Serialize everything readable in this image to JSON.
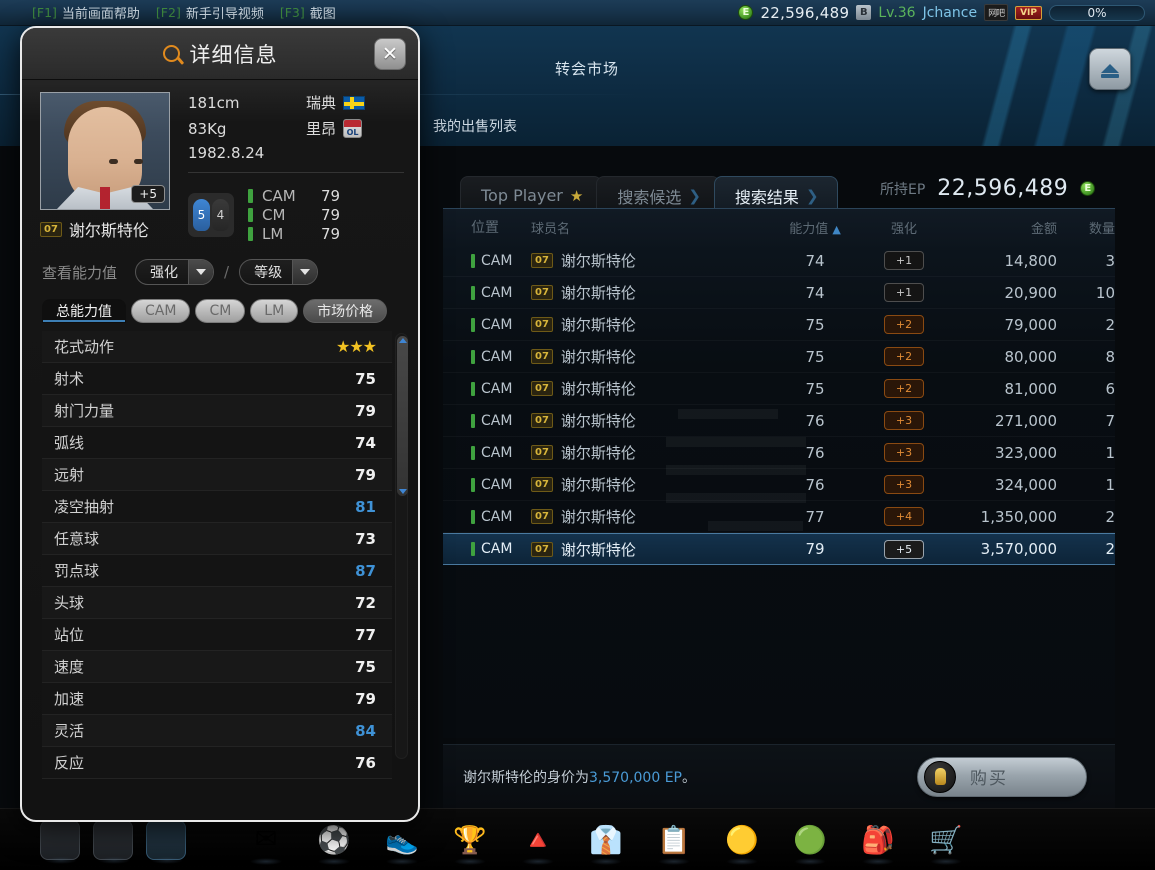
{
  "sysbar": {
    "hotkeys": [
      {
        "key": "[F1]",
        "label": "当前画面帮助"
      },
      {
        "key": "[F2]",
        "label": "新手引导视频"
      },
      {
        "key": "[F3]",
        "label": "截图"
      }
    ],
    "ep_icon": "E",
    "ep_amount": "22,596,489",
    "b_badge": "B",
    "level": "Lv.36",
    "username": "Jchance",
    "tag_forum": "网吧",
    "tag_vip": "VIP",
    "progress": "0%"
  },
  "market": {
    "title": "转会市场",
    "subnav": "我的出售列表",
    "eject_icon": "eject-icon",
    "tabs": [
      {
        "label": "Top Player",
        "icon": "star-icon",
        "active": false
      },
      {
        "label": "搜索候选",
        "icon": "chevron-right-icon",
        "active": false
      },
      {
        "label": "搜索结果",
        "icon": "chevron-right-icon",
        "active": true
      }
    ],
    "ep_hold_label": "所持EP",
    "ep_hold_value": "22,596,489",
    "columns": [
      "位置",
      "球员名",
      "能力值",
      "强化",
      "金额",
      "数量"
    ],
    "sort_indicator": "▲",
    "rows": [
      {
        "pos": "CAM",
        "num": "07",
        "name": "谢尔斯特伦",
        "ovr": "74",
        "enh": "+1",
        "enh_lv": 1,
        "price": "14,800",
        "qty": "3",
        "selected": false
      },
      {
        "pos": "CAM",
        "num": "07",
        "name": "谢尔斯特伦",
        "ovr": "74",
        "enh": "+1",
        "enh_lv": 1,
        "price": "20,900",
        "qty": "10",
        "selected": false
      },
      {
        "pos": "CAM",
        "num": "07",
        "name": "谢尔斯特伦",
        "ovr": "75",
        "enh": "+2",
        "enh_lv": 2,
        "price": "79,000",
        "qty": "2",
        "selected": false
      },
      {
        "pos": "CAM",
        "num": "07",
        "name": "谢尔斯特伦",
        "ovr": "75",
        "enh": "+2",
        "enh_lv": 2,
        "price": "80,000",
        "qty": "8",
        "selected": false
      },
      {
        "pos": "CAM",
        "num": "07",
        "name": "谢尔斯特伦",
        "ovr": "75",
        "enh": "+2",
        "enh_lv": 2,
        "price": "81,000",
        "qty": "6",
        "selected": false
      },
      {
        "pos": "CAM",
        "num": "07",
        "name": "谢尔斯特伦",
        "ovr": "76",
        "enh": "+3",
        "enh_lv": 3,
        "price": "271,000",
        "qty": "7",
        "selected": false
      },
      {
        "pos": "CAM",
        "num": "07",
        "name": "谢尔斯特伦",
        "ovr": "76",
        "enh": "+3",
        "enh_lv": 3,
        "price": "323,000",
        "qty": "1",
        "selected": false
      },
      {
        "pos": "CAM",
        "num": "07",
        "name": "谢尔斯特伦",
        "ovr": "76",
        "enh": "+3",
        "enh_lv": 3,
        "price": "324,000",
        "qty": "1",
        "selected": false
      },
      {
        "pos": "CAM",
        "num": "07",
        "name": "谢尔斯特伦",
        "ovr": "77",
        "enh": "+4",
        "enh_lv": 4,
        "price": "1,350,000",
        "qty": "2",
        "selected": false
      },
      {
        "pos": "CAM",
        "num": "07",
        "name": "谢尔斯特伦",
        "ovr": "79",
        "enh": "+5",
        "enh_lv": 5,
        "price": "3,570,000",
        "qty": "2",
        "selected": true
      }
    ],
    "buy_msg_pre": "谢尔斯特伦的身价为",
    "buy_msg_price": "3,570,000 EP",
    "buy_msg_post": "。",
    "buy_button": "购买"
  },
  "dialog": {
    "title": "详细信息",
    "title_icon": "search-icon",
    "close_icon": "close-icon",
    "player": {
      "height": "181cm",
      "weight": "83Kg",
      "birthdate": "1982.8.24",
      "country": "瑞典",
      "club": "里昂",
      "name": "谢尔斯特伦",
      "shirt_number": "07",
      "enhance_badge": "+5",
      "foot_left": "5",
      "foot_right": "4",
      "positions": [
        {
          "name": "CAM",
          "value": "79"
        },
        {
          "name": "CM",
          "value": "79"
        },
        {
          "name": "LM",
          "value": "79"
        }
      ]
    },
    "view_label": "查看能力值",
    "dropdown_enhance": "强化",
    "dropdown_level": "等级",
    "separator": "/",
    "attr_tabs": [
      {
        "label": "总能力值",
        "style": "on"
      },
      {
        "label": "CAM",
        "style": "light"
      },
      {
        "label": "CM",
        "style": "light"
      },
      {
        "label": "LM",
        "style": "light"
      },
      {
        "label": "市场价格",
        "style": "dark"
      }
    ],
    "stats": [
      {
        "name": "花式动作",
        "value": "★★★",
        "type": "stars"
      },
      {
        "name": "射术",
        "value": "75",
        "type": "num"
      },
      {
        "name": "射门力量",
        "value": "79",
        "type": "num"
      },
      {
        "name": "弧线",
        "value": "74",
        "type": "num"
      },
      {
        "name": "远射",
        "value": "79",
        "type": "num"
      },
      {
        "name": "凌空抽射",
        "value": "81",
        "type": "num",
        "highlight": true
      },
      {
        "name": "任意球",
        "value": "73",
        "type": "num"
      },
      {
        "name": "罚点球",
        "value": "87",
        "type": "num",
        "highlight": true
      },
      {
        "name": "头球",
        "value": "72",
        "type": "num"
      },
      {
        "name": "站位",
        "value": "77",
        "type": "num"
      },
      {
        "name": "速度",
        "value": "75",
        "type": "num"
      },
      {
        "name": "加速",
        "value": "79",
        "type": "num"
      },
      {
        "name": "灵活",
        "value": "84",
        "type": "num",
        "highlight": true
      },
      {
        "name": "反应",
        "value": "76",
        "type": "num"
      }
    ]
  },
  "taskbar": {
    "left_icons": [
      "home-icon",
      "chat-icon",
      "gallery-icon"
    ],
    "right_icons": [
      "pyramid-rank-icon",
      "shirt-tie-icon",
      "clipboard-icon",
      "coin-icon",
      "club-badge-icon",
      "bag-icon",
      "cart-icon"
    ],
    "object_icons": [
      "envelope-icon",
      "soccer-ball-icon",
      "boot-icon",
      "trophy-icon"
    ]
  },
  "colors": {
    "accent_blue": "#3f92d6",
    "position_green": "#3fa23f",
    "enhance_orange": "#e08b35",
    "star_gold": "#f2c222"
  }
}
